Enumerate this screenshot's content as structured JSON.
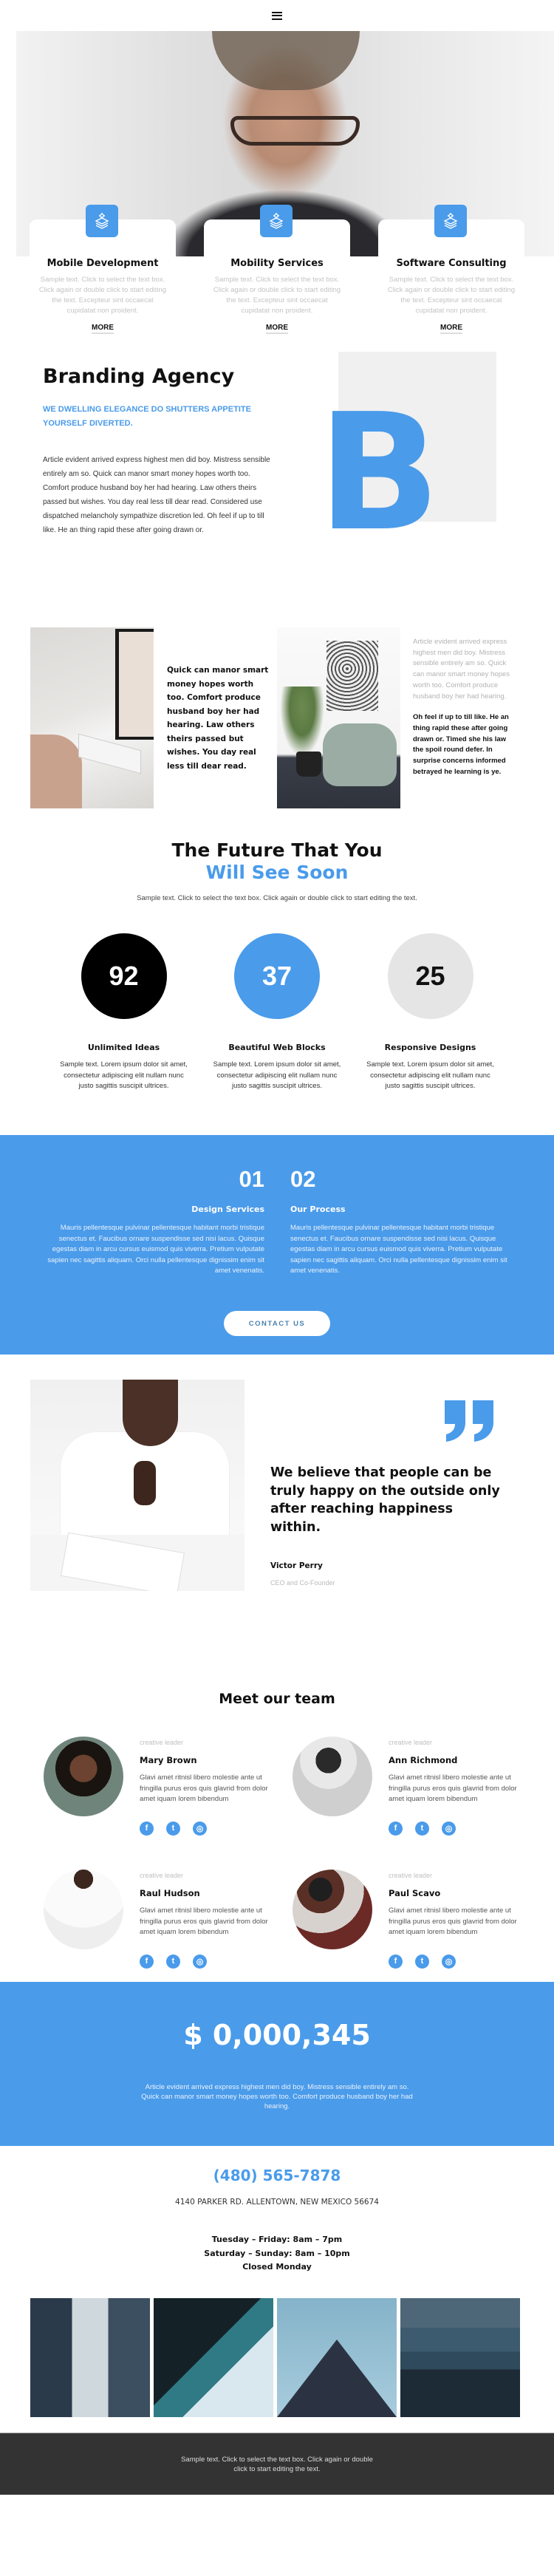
{
  "header": {
    "menu_icon": "hamburger-menu-icon"
  },
  "hero": {
    "cards": [
      {
        "icon": "stack-layers-icon",
        "title": "Mobile Development",
        "text": "Sample text. Click to select the text box. Click again or double click to start editing the text. Excepteur sint occaecat cupidatat non proident.",
        "more": "MORE"
      },
      {
        "icon": "stack-layers-icon",
        "title": "Mobility Services",
        "text": "Sample text. Click to select the text box. Click again or double click to start editing the text. Excepteur sint occaecat cupidatat non proident.",
        "more": "MORE"
      },
      {
        "icon": "stack-layers-icon",
        "title": "Software Consulting",
        "text": "Sample text. Click to select the text box. Click again or double click to start editing the text. Excepteur sint occaecat cupidatat non proident.",
        "more": "MORE"
      }
    ]
  },
  "branding": {
    "title": "Branding Agency",
    "subtitle": "WE DWELLING ELEGANCE DO SHUTTERS APPETITE YOURSELF DIVERTED.",
    "body": "Article evident arrived express highest men did boy. Mistress sensible entirely am so. Quick can manor smart money hopes worth too. Comfort produce husband boy her had hearing. Law others theirs passed but wishes. You day real less till dear read. Considered use dispatched melancholy sympathize discretion led. Oh feel if up to till like. He an thing rapid these after going drawn or.",
    "letter": "B"
  },
  "features": {
    "left_text": "Quick can manor smart money hopes worth too. Comfort produce husband boy her had hearing. Law others theirs passed but wishes. You day real less till dear read.",
    "right_gray": "Article evident arrived express highest men did boy. Mistress sensible entirely am so. Quick can manor smart money hopes worth too. Comfort produce husband boy her had hearing.",
    "right_bold": "Oh feel if up to till like. He an thing rapid these after going drawn or. Timed she his law the spoil round defer. In surprise concerns informed betrayed he learning is ye."
  },
  "future": {
    "title_line1": "The Future That You",
    "title_line2": "Will See Soon",
    "subtitle": "Sample text. Click to select the text box. Click again or double click to start editing the text.",
    "stats": [
      {
        "value": "92",
        "title": "Unlimited Ideas",
        "text": "Sample text. Lorem ipsum dolor sit amet, consectetur adipiscing elit nullam nunc justo sagittis suscipit ultrices."
      },
      {
        "value": "37",
        "title": "Beautiful Web Blocks",
        "text": "Sample text. Lorem ipsum dolor sit amet, consectetur adipiscing elit nullam nunc justo sagittis suscipit ultrices."
      },
      {
        "value": "25",
        "title": "Responsive Designs",
        "text": "Sample text. Lorem ipsum dolor sit amet, consectetur adipiscing elit nullam nunc justo sagittis suscipit ultrices."
      }
    ]
  },
  "process": {
    "columns": [
      {
        "number": "01",
        "title": "Design Services",
        "text": "Mauris pellentesque pulvinar pellentesque habitant morbi tristique senectus et. Faucibus ornare suspendisse sed nisi lacus. Quisque egestas diam in arcu cursus euismod quis viverra. Pretium vulputate sapien nec sagittis aliquam. Orci nulla pellentesque dignissim enim sit amet venenatis."
      },
      {
        "number": "02",
        "title": "Our Process",
        "text": "Mauris pellentesque pulvinar pellentesque habitant morbi tristique senectus et. Faucibus ornare suspendisse sed nisi lacus. Quisque egestas diam in arcu cursus euismod quis viverra. Pretium vulputate sapien nec sagittis aliquam. Orci nulla pellentesque dignissim enim sit amet venenatis."
      }
    ],
    "button": "CONTACT US"
  },
  "quote": {
    "text": "We believe that people can be truly happy on the outside only after reaching happiness within.",
    "name": "Victor Perry",
    "role": "CEO and Co-Founder"
  },
  "team": {
    "title": "Meet our team",
    "members": [
      {
        "role": "creative leader",
        "name": "Mary Brown",
        "text": "Glavi amet ritnisl libero molestie ante ut fringilla purus eros quis glavrid from dolor amet iquam lorem bibendum"
      },
      {
        "role": "creative leader",
        "name": "Ann Richmond",
        "text": "Glavi amet ritnisl libero molestie ante ut fringilla purus eros quis glavrid from dolor amet iquam lorem bibendum"
      },
      {
        "role": "creative leader",
        "name": "Raul Hudson",
        "text": "Glavi amet ritnisl libero molestie ante ut fringilla purus eros quis glavrid from dolor amet iquam lorem bibendum"
      },
      {
        "role": "creative leader",
        "name": "Paul Scavo",
        "text": "Glavi amet ritnisl libero molestie ante ut fringilla purus eros quis glavrid from dolor amet iquam lorem bibendum"
      }
    ],
    "social": {
      "facebook": "f",
      "twitter": "t",
      "instagram": "◎"
    }
  },
  "revenue": {
    "value": "$ 0,000,345",
    "text": "Article evident arrived express highest men did boy. Mistress sensible entirely am so. Quick can manor smart money hopes worth too. Comfort produce husband boy her had hearing."
  },
  "contact": {
    "phone": "(480) 565-7878",
    "address": "4140 PARKER RD. ALLENTOWN, NEW MEXICO 56674",
    "hours": [
      "Tuesday – Friday: 8am – 7pm",
      "Saturday – Sunday: 8am – 10pm",
      "Closed Monday"
    ]
  },
  "footer": {
    "text": "Sample text. Click to select the text box. Click again or double click to start editing the text."
  },
  "colors": {
    "accent": "#4a9bea",
    "dark": "#333333",
    "black_circle": "#000000",
    "gray_circle": "#e5e5e5"
  }
}
